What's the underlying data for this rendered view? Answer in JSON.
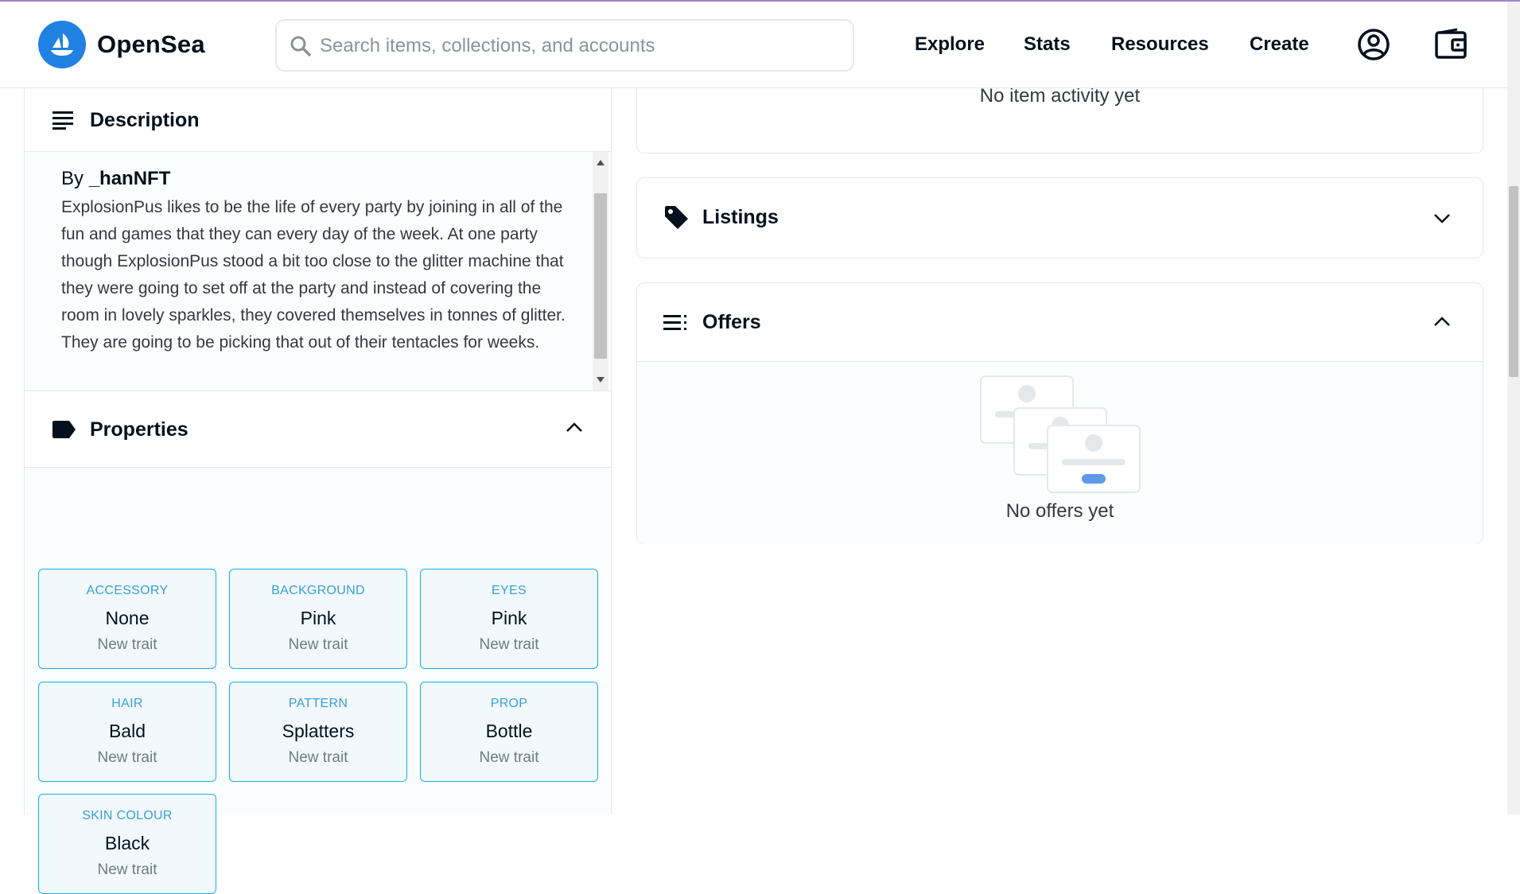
{
  "header": {
    "brand": "OpenSea",
    "search_placeholder": "Search items, collections, and accounts",
    "nav": [
      "Explore",
      "Stats",
      "Resources",
      "Create"
    ],
    "accent_color": "#2081e2"
  },
  "description": {
    "title": "Description",
    "by_prefix": "By",
    "creator": "_hanNFT",
    "text": "ExplosionPus likes to be the life of every party by joining in all of the fun and games that they can every day of the week. At one party though ExplosionPus stood a bit too close to the glitter machine that they were going to set off at the party and instead of covering the room in lovely sparkles, they covered themselves in tonnes of glitter. They are going to be picking that out of their tentacles for weeks."
  },
  "properties": {
    "title": "Properties",
    "traits": [
      {
        "type": "ACCESSORY",
        "value": "None",
        "rarity": "New trait"
      },
      {
        "type": "BACKGROUND",
        "value": "Pink",
        "rarity": "New trait"
      },
      {
        "type": "EYES",
        "value": "Pink",
        "rarity": "New trait"
      },
      {
        "type": "HAIR",
        "value": "Bald",
        "rarity": "New trait"
      },
      {
        "type": "PATTERN",
        "value": "Splatters",
        "rarity": "New trait"
      },
      {
        "type": "PROP",
        "value": "Bottle",
        "rarity": "New trait"
      },
      {
        "type": "SKIN COLOUR",
        "value": "Black",
        "rarity": "New trait"
      }
    ]
  },
  "activity": {
    "empty_text": "No item activity yet"
  },
  "listings": {
    "title": "Listings"
  },
  "offers": {
    "title": "Offers",
    "empty_text": "No offers yet"
  },
  "icons": [
    "search-icon",
    "account-icon",
    "wallet-icon",
    "description-lines-icon",
    "label-icon",
    "tag-icon",
    "offers-list-icon",
    "chevron-up-icon",
    "chevron-down-icon"
  ]
}
